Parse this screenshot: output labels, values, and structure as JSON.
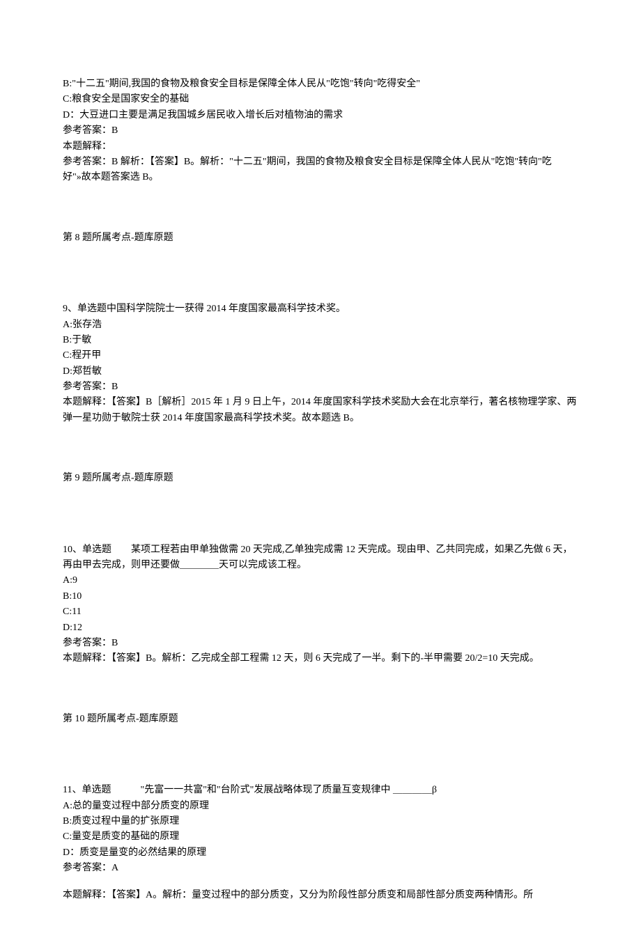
{
  "q7_tail": {
    "optB": "B:\"十二五\"期间,我国的食物及粮食安全目标是保障全体人民从\"吃饱\"转向\"吃得安全\"",
    "optC": "C:粮食安全是国家安全的基础",
    "optD": "D：大豆进口主要是满足我国城乡居民收入增长后对植物油的需求",
    "ans": "参考答案：B",
    "exp_label": "本题解释：",
    "exp": "参考答案：B 解析：【答案】B。解析：\"十二五\"期间，我国的食物及粮食安全目标是保障全体人民从\"吃饱\"转向\"吃好\"»故本题答案选 B。"
  },
  "q8_topic": "第 8 题所属考点-题库原题",
  "q9": {
    "stem": "9、单选题中国科学院院士一获得 2014 年度国家最高科学技术奖。",
    "optA": "A:张存浩",
    "optB": "B:于敏",
    "optC": "C:程开甲",
    "optD": "D:郑哲敏",
    "ans": "参考答案：B",
    "exp": "本题解释：【答案】B［解析］2015 年 1 月 9 日上午，2014 年度国家科学技术奖励大会在北京举行，著名核物理学家、两弹一星功勋于敏院士获 2014 年度国家最高科学技术奖。故本题选 B。"
  },
  "q9_topic": "第 9 题所属考点-题库原题",
  "q10": {
    "stem": "10、单选题　　某项工程若由甲单独做需 20 天完成,乙单独完成需 12 天完成。现由甲、乙共同完成，如果乙先做 6 天，再由甲去完成，则甲还要做＿＿＿＿天可以完成该工程。",
    "optA": "A:9",
    "optB": "B:10",
    "optC": "C:11",
    "optD": "D:12",
    "ans": "参考答案：B",
    "exp": "本题解释：【答案】B。解析：乙完成全部工程需 12 天，则 6 天完成了一半。剩下的-半甲需要 20/2=10 天完成。"
  },
  "q10_topic": "第 10 题所属考点-题库原题",
  "q11": {
    "stem": "11、单选题　　　\"先富一一共富\"和\"台阶式\"发展战略体现了质量互变规律中 ＿＿＿＿β",
    "optA": "A:总的量变过程中部分质变的原理",
    "optB": "B:质变过程中量的扩张原理",
    "optC": "C:量变是质变的基础的原理",
    "optD": "D：质变是量变的必然结果的原理",
    "ans": "参考答案：A",
    "exp": "本题解释：【答案】A。解析：量变过程中的部分质变，又分为阶段性部分质变和局部性部分质变两种情形。所"
  }
}
